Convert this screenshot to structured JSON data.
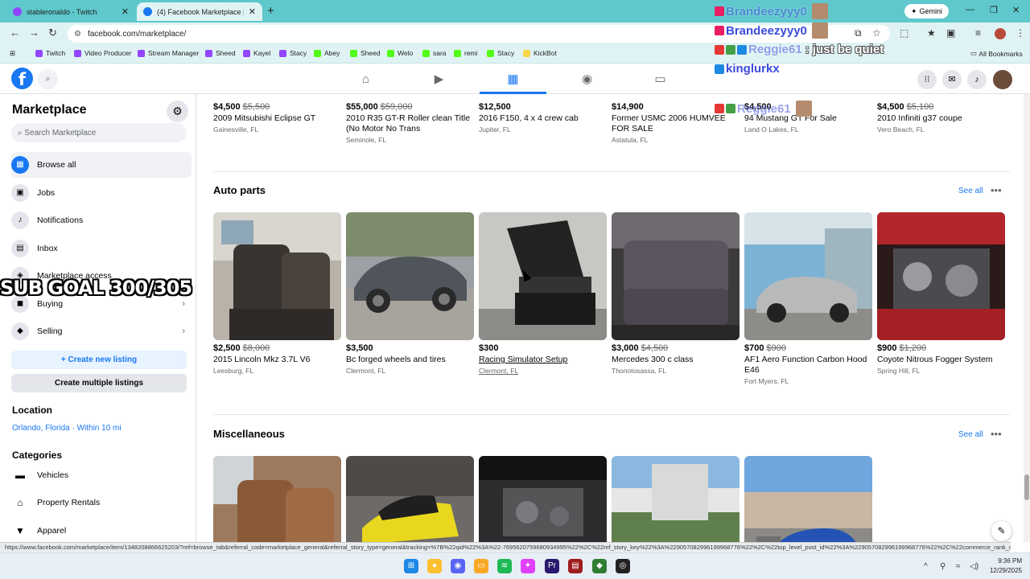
{
  "browser": {
    "tabs": [
      {
        "title": "stableronaldo - Twitch",
        "color": "#9146ff"
      },
      {
        "title": "(4) Facebook Marketplace | Face",
        "color": "#1877f2"
      }
    ],
    "new_tab": "+",
    "gemini": "Gemini",
    "url": "facebook.com/marketplace/",
    "bookmarks": [
      {
        "label": "Twitch",
        "color": "#9146ff"
      },
      {
        "label": "Video Producer",
        "color": "#9146ff"
      },
      {
        "label": "Stream Manager",
        "color": "#9146ff"
      },
      {
        "label": "Sheed",
        "color": "#9146ff"
      },
      {
        "label": "Kayel",
        "color": "#9146ff"
      },
      {
        "label": "Stacy",
        "color": "#9146ff"
      },
      {
        "label": "Abey",
        "color": "#53fc18"
      },
      {
        "label": "Sheed",
        "color": "#53fc18"
      },
      {
        "label": "Welo",
        "color": "#53fc18"
      },
      {
        "label": "sara",
        "color": "#53fc18"
      },
      {
        "label": "remi",
        "color": "#53fc18"
      },
      {
        "label": "Stacy",
        "color": "#53fc18"
      },
      {
        "label": "KickBot",
        "color": "#f7d64a"
      }
    ],
    "all_bookmarks": "All Bookmarks",
    "status_url": "https://www.facebook.com/marketplace/item/1348208866625203/?ref=browse_tab&referral_code=marketplace_general&referral_story_type=general&tracking=%7B%22qid%22%3A%22-7695620759680934995%22%2C%22mf_story_key%22%3A%229057082996199968776%22%2C%22top_level_post_id%22%3A%229057082996199968776%22%2C%22commerce_rank_obj%22%3A%22%7B%5C%22target_id..."
  },
  "sidebar": {
    "title": "Marketplace",
    "search_placeholder": "Search Marketplace",
    "items": [
      {
        "label": "Browse all",
        "icon": "storefront-icon"
      },
      {
        "label": "Jobs",
        "icon": "briefcase-icon"
      },
      {
        "label": "Notifications",
        "icon": "bell-icon"
      },
      {
        "label": "Inbox",
        "icon": "inbox-icon"
      },
      {
        "label": "Marketplace access",
        "icon": "shield-icon"
      },
      {
        "label": "Buying",
        "icon": "bag-icon"
      },
      {
        "label": "Selling",
        "icon": "tag-icon"
      }
    ],
    "create_listing": "+ Create new listing",
    "create_multiple": "Create multiple listings",
    "location_head": "Location",
    "location": "Orlando, Florida · Within 10 mi",
    "categories_head": "Categories",
    "categories": [
      "Vehicles",
      "Property Rentals",
      "Apparel"
    ]
  },
  "overlay": {
    "sub_goal": "SUB GOAL 300/305"
  },
  "chat": [
    {
      "user": "Brandeezyyy0",
      "msg": ""
    },
    {
      "user": "Brandeezyyy0",
      "msg": ""
    },
    {
      "user": "Reggie61",
      "msg": ": just be quiet"
    },
    {
      "user": "kinglurkx",
      "msg": ""
    },
    {
      "user": "Reggie61",
      "msg": ""
    }
  ],
  "vehicles_row": [
    {
      "price": "$4,500",
      "old": "$5,500",
      "title": "2009 Mitsubishi Eclipse GT",
      "loc": "Gainesville, FL"
    },
    {
      "price": "$55,000",
      "old": "$59,000",
      "title": "2010 R35 GT-R Roller clean Title (No Motor No Trans",
      "loc": "Seminole, FL"
    },
    {
      "price": "$12,500",
      "old": "",
      "title": "2016 F150, 4 x 4 crew cab",
      "loc": "Jupiter, FL"
    },
    {
      "price": "$14,900",
      "old": "",
      "title": "Former USMC 2006 HUMVEE FOR SALE",
      "loc": "Astatula, FL"
    },
    {
      "price": "$4,500",
      "old": "",
      "title": "94 Mustang GT For Sale",
      "loc": "Land O Lakes, FL"
    },
    {
      "price": "$4,500",
      "old": "$5,100",
      "title": "2010 Infiniti g37 coupe",
      "loc": "Vero Beach, FL"
    }
  ],
  "auto_parts": {
    "title": "Auto parts",
    "see_all": "See all",
    "items": [
      {
        "price": "$2,500",
        "old": "$8,000",
        "title": "2015 Lincoln Mkz 3.7L V6",
        "loc": "Leesburg, FL"
      },
      {
        "price": "$3,500",
        "old": "",
        "title": "Bc forged wheels and tires",
        "loc": "Clermont, FL"
      },
      {
        "price": "$300",
        "old": "",
        "title": "Racing Simulator Setup",
        "loc": "Clermont, FL"
      },
      {
        "price": "$3,000",
        "old": "$4,500",
        "title": "Mercedes 300 c class",
        "loc": "Thonotosassa, FL"
      },
      {
        "price": "$700",
        "old": "$900",
        "title": "AF1 Aero Function Carbon Hood E46",
        "loc": "Fort Myers, FL"
      },
      {
        "price": "$900",
        "old": "$1,200",
        "title": "Coyote Nitrous Fogger System",
        "loc": "Spring Hill, FL"
      }
    ]
  },
  "misc": {
    "title": "Miscellaneous",
    "see_all": "See all"
  },
  "taskbar": {
    "time": "9:36 PM",
    "date": "12/29/2025"
  }
}
